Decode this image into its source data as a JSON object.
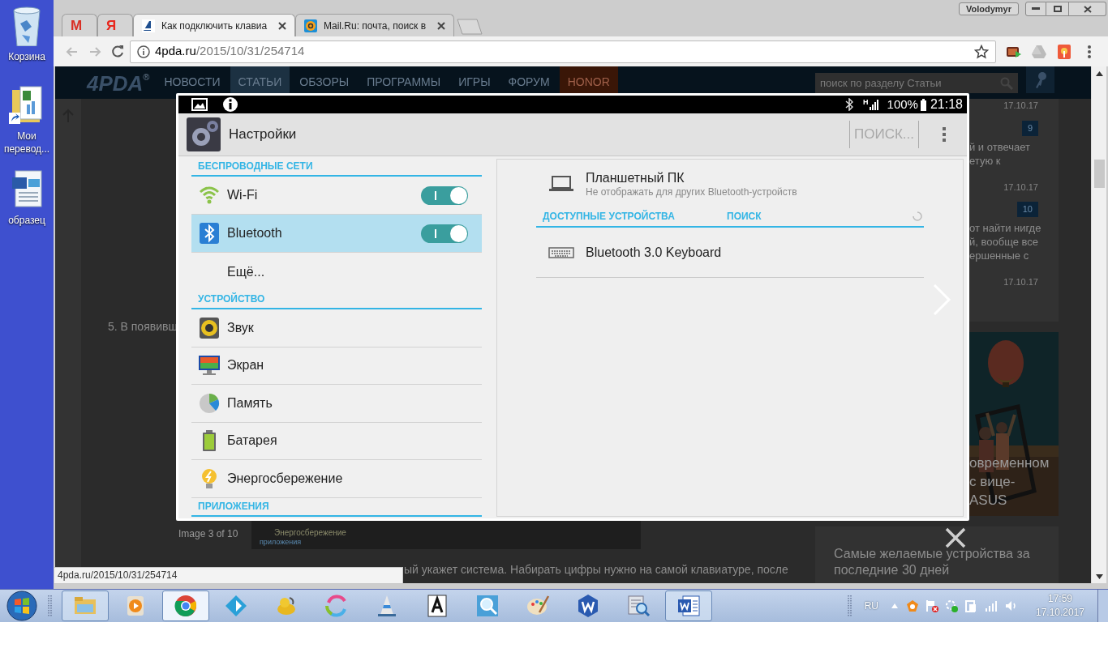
{
  "desktop": [
    {
      "label": "Корзина",
      "shortcut": false
    },
    {
      "label": "Мои перевод...",
      "shortcut": true
    },
    {
      "label": "образец",
      "shortcut": false
    }
  ],
  "browser": {
    "profile": "Volodymyr",
    "tabs": [
      {
        "glyph": "M",
        "selected": false
      },
      {
        "glyph": "Я",
        "selected": false
      },
      {
        "title": "Как подключить клавиа",
        "selected": true
      },
      {
        "title": "Mail.Ru: почта, поиск в",
        "selected": false
      }
    ],
    "url": {
      "host": "4pda.ru",
      "path": "/2015/10/31/254714"
    },
    "status_url": "4pda.ru/2015/10/31/254714"
  },
  "site": {
    "logo": "4PDA",
    "logo_mark": "®",
    "nav": [
      {
        "label": "НОВОСТИ",
        "selected": false,
        "kind": "link"
      },
      {
        "label": "СТАТЬИ",
        "selected": true,
        "kind": "link"
      },
      {
        "label": "ОБЗОРЫ",
        "selected": false,
        "kind": "link"
      },
      {
        "label": "ПРОГРАММЫ",
        "selected": false,
        "kind": "link"
      },
      {
        "label": "ИГРЫ",
        "selected": false,
        "kind": "link"
      },
      {
        "label": "ФОРУМ",
        "selected": false,
        "kind": "link"
      },
      {
        "label": "HONOR",
        "selected": false,
        "kind": "promo"
      }
    ],
    "search": {
      "placeholder": "поиск по разделу Статьи"
    },
    "article_lines": [
      "5. В появивш",
      "ый укажет система. Набирать цифры нужно на самой клавиатуре, после"
    ],
    "sidebar": [
      {
        "date": "17.10.17"
      },
      {
        "badge": "9",
        "lines": [
          "й и отвечает",
          "етую к"
        ],
        "date": "17.10.17"
      },
      {
        "badge": "10",
        "lines": [
          "от найти нигде",
          "й, вообще все",
          "ершенные с"
        ],
        "date": "17.10.17"
      }
    ],
    "promo": {
      "kind": "picture",
      "caption": [
        "овременном",
        "с вице-",
        "ASUS"
      ]
    },
    "card_title": "Самые желаемые устройства за последние 30 дней"
  },
  "lightbox": {
    "counter": "Image 3 of 10",
    "behind": [
      "Энергосбережение",
      "приложения"
    ],
    "screen": {
      "status": {
        "network": "H",
        "battery": "100%",
        "time": "21:18"
      },
      "title": "Настройки",
      "search": "ПОИСК...",
      "sections": [
        {
          "title": "БЕСПРОВОДНЫЕ СЕТИ",
          "items": [
            {
              "label": "Wi-Fi",
              "kind": "toggle",
              "on": true,
              "selected": false
            },
            {
              "label": "Bluetooth",
              "kind": "toggle",
              "on": true,
              "selected": true
            },
            {
              "label": "Ещё...",
              "kind": "link",
              "selected": false
            }
          ]
        },
        {
          "title": "УСТРОЙСТВО",
          "items": [
            {
              "label": "Звук",
              "kind": "link",
              "selected": false
            },
            {
              "label": "Экран",
              "kind": "link",
              "selected": false
            },
            {
              "label": "Память",
              "kind": "link",
              "selected": false
            },
            {
              "label": "Батарея",
              "kind": "link",
              "selected": false
            },
            {
              "label": "Энергосбережение",
              "kind": "link",
              "selected": false
            }
          ]
        },
        {
          "title": "ПРИЛОЖЕНИЯ"
        }
      ],
      "device": {
        "name": "Планшетный ПК",
        "note": "Не отображать для других Bluetooth-устройств"
      },
      "list_header": "ДОСТУПНЫЕ УСТРОЙСТВА",
      "search_action": "ПОИСК",
      "devices": [
        {
          "name": "Bluetooth 3.0 Keyboard"
        }
      ]
    }
  },
  "taskbar": {
    "items": [
      {
        "open": true,
        "selected": false
      },
      {
        "open": false,
        "selected": false
      },
      {
        "open": true,
        "selected": true
      },
      {
        "open": false,
        "selected": false
      },
      {
        "open": false,
        "selected": false
      },
      {
        "open": false,
        "selected": false
      },
      {
        "open": false,
        "selected": false
      },
      {
        "open": false,
        "selected": false
      },
      {
        "open": false,
        "selected": false
      },
      {
        "open": false,
        "selected": false
      },
      {
        "open": false,
        "selected": false
      },
      {
        "open": false,
        "selected": false
      },
      {
        "open": true,
        "selected": false
      }
    ],
    "tray": {
      "language": "RU",
      "time": "17:59",
      "date": "17.10.2017"
    }
  }
}
